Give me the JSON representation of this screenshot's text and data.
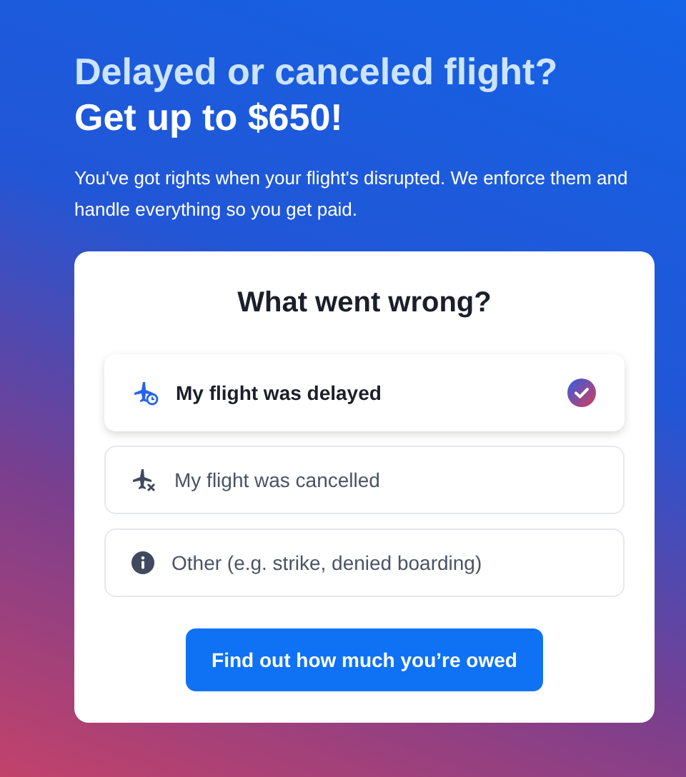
{
  "hero": {
    "headline": "Delayed or canceled flight?",
    "subheadline": "Get up to $650!",
    "description": "You've got rights when your flight's disrupted. We enforce them and handle everything so you get paid."
  },
  "card": {
    "title": "What went wrong?",
    "options": [
      {
        "kind": "delayed",
        "label": "My flight was delayed",
        "selected": true
      },
      {
        "kind": "cancelled",
        "label": "My flight was cancelled",
        "selected": false
      },
      {
        "kind": "other",
        "label": "Other (e.g. strike, denied boarding)",
        "selected": false
      }
    ],
    "button": "Find out how much you’re owed"
  }
}
